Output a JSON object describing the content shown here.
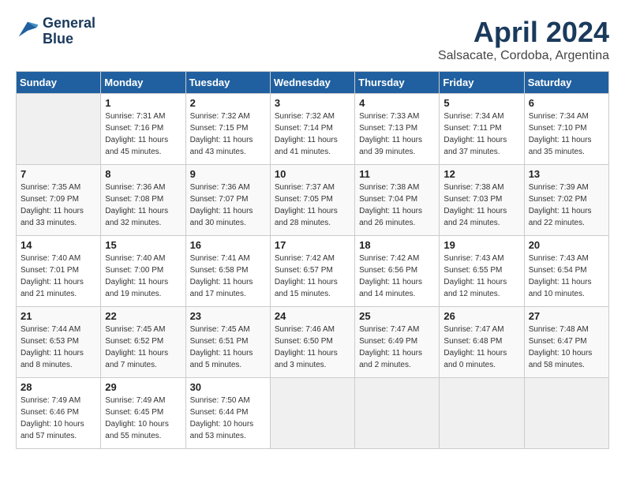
{
  "header": {
    "logo_line1": "General",
    "logo_line2": "Blue",
    "month": "April 2024",
    "location": "Salsacate, Cordoba, Argentina"
  },
  "columns": [
    "Sunday",
    "Monday",
    "Tuesday",
    "Wednesday",
    "Thursday",
    "Friday",
    "Saturday"
  ],
  "weeks": [
    [
      {
        "day": "",
        "empty": true
      },
      {
        "day": "1",
        "sunrise": "Sunrise: 7:31 AM",
        "sunset": "Sunset: 7:16 PM",
        "daylight": "Daylight: 11 hours and 45 minutes."
      },
      {
        "day": "2",
        "sunrise": "Sunrise: 7:32 AM",
        "sunset": "Sunset: 7:15 PM",
        "daylight": "Daylight: 11 hours and 43 minutes."
      },
      {
        "day": "3",
        "sunrise": "Sunrise: 7:32 AM",
        "sunset": "Sunset: 7:14 PM",
        "daylight": "Daylight: 11 hours and 41 minutes."
      },
      {
        "day": "4",
        "sunrise": "Sunrise: 7:33 AM",
        "sunset": "Sunset: 7:13 PM",
        "daylight": "Daylight: 11 hours and 39 minutes."
      },
      {
        "day": "5",
        "sunrise": "Sunrise: 7:34 AM",
        "sunset": "Sunset: 7:11 PM",
        "daylight": "Daylight: 11 hours and 37 minutes."
      },
      {
        "day": "6",
        "sunrise": "Sunrise: 7:34 AM",
        "sunset": "Sunset: 7:10 PM",
        "daylight": "Daylight: 11 hours and 35 minutes."
      }
    ],
    [
      {
        "day": "7",
        "sunrise": "Sunrise: 7:35 AM",
        "sunset": "Sunset: 7:09 PM",
        "daylight": "Daylight: 11 hours and 33 minutes."
      },
      {
        "day": "8",
        "sunrise": "Sunrise: 7:36 AM",
        "sunset": "Sunset: 7:08 PM",
        "daylight": "Daylight: 11 hours and 32 minutes."
      },
      {
        "day": "9",
        "sunrise": "Sunrise: 7:36 AM",
        "sunset": "Sunset: 7:07 PM",
        "daylight": "Daylight: 11 hours and 30 minutes."
      },
      {
        "day": "10",
        "sunrise": "Sunrise: 7:37 AM",
        "sunset": "Sunset: 7:05 PM",
        "daylight": "Daylight: 11 hours and 28 minutes."
      },
      {
        "day": "11",
        "sunrise": "Sunrise: 7:38 AM",
        "sunset": "Sunset: 7:04 PM",
        "daylight": "Daylight: 11 hours and 26 minutes."
      },
      {
        "day": "12",
        "sunrise": "Sunrise: 7:38 AM",
        "sunset": "Sunset: 7:03 PM",
        "daylight": "Daylight: 11 hours and 24 minutes."
      },
      {
        "day": "13",
        "sunrise": "Sunrise: 7:39 AM",
        "sunset": "Sunset: 7:02 PM",
        "daylight": "Daylight: 11 hours and 22 minutes."
      }
    ],
    [
      {
        "day": "14",
        "sunrise": "Sunrise: 7:40 AM",
        "sunset": "Sunset: 7:01 PM",
        "daylight": "Daylight: 11 hours and 21 minutes."
      },
      {
        "day": "15",
        "sunrise": "Sunrise: 7:40 AM",
        "sunset": "Sunset: 7:00 PM",
        "daylight": "Daylight: 11 hours and 19 minutes."
      },
      {
        "day": "16",
        "sunrise": "Sunrise: 7:41 AM",
        "sunset": "Sunset: 6:58 PM",
        "daylight": "Daylight: 11 hours and 17 minutes."
      },
      {
        "day": "17",
        "sunrise": "Sunrise: 7:42 AM",
        "sunset": "Sunset: 6:57 PM",
        "daylight": "Daylight: 11 hours and 15 minutes."
      },
      {
        "day": "18",
        "sunrise": "Sunrise: 7:42 AM",
        "sunset": "Sunset: 6:56 PM",
        "daylight": "Daylight: 11 hours and 14 minutes."
      },
      {
        "day": "19",
        "sunrise": "Sunrise: 7:43 AM",
        "sunset": "Sunset: 6:55 PM",
        "daylight": "Daylight: 11 hours and 12 minutes."
      },
      {
        "day": "20",
        "sunrise": "Sunrise: 7:43 AM",
        "sunset": "Sunset: 6:54 PM",
        "daylight": "Daylight: 11 hours and 10 minutes."
      }
    ],
    [
      {
        "day": "21",
        "sunrise": "Sunrise: 7:44 AM",
        "sunset": "Sunset: 6:53 PM",
        "daylight": "Daylight: 11 hours and 8 minutes."
      },
      {
        "day": "22",
        "sunrise": "Sunrise: 7:45 AM",
        "sunset": "Sunset: 6:52 PM",
        "daylight": "Daylight: 11 hours and 7 minutes."
      },
      {
        "day": "23",
        "sunrise": "Sunrise: 7:45 AM",
        "sunset": "Sunset: 6:51 PM",
        "daylight": "Daylight: 11 hours and 5 minutes."
      },
      {
        "day": "24",
        "sunrise": "Sunrise: 7:46 AM",
        "sunset": "Sunset: 6:50 PM",
        "daylight": "Daylight: 11 hours and 3 minutes."
      },
      {
        "day": "25",
        "sunrise": "Sunrise: 7:47 AM",
        "sunset": "Sunset: 6:49 PM",
        "daylight": "Daylight: 11 hours and 2 minutes."
      },
      {
        "day": "26",
        "sunrise": "Sunrise: 7:47 AM",
        "sunset": "Sunset: 6:48 PM",
        "daylight": "Daylight: 11 hours and 0 minutes."
      },
      {
        "day": "27",
        "sunrise": "Sunrise: 7:48 AM",
        "sunset": "Sunset: 6:47 PM",
        "daylight": "Daylight: 10 hours and 58 minutes."
      }
    ],
    [
      {
        "day": "28",
        "sunrise": "Sunrise: 7:49 AM",
        "sunset": "Sunset: 6:46 PM",
        "daylight": "Daylight: 10 hours and 57 minutes."
      },
      {
        "day": "29",
        "sunrise": "Sunrise: 7:49 AM",
        "sunset": "Sunset: 6:45 PM",
        "daylight": "Daylight: 10 hours and 55 minutes."
      },
      {
        "day": "30",
        "sunrise": "Sunrise: 7:50 AM",
        "sunset": "Sunset: 6:44 PM",
        "daylight": "Daylight: 10 hours and 53 minutes."
      },
      {
        "day": "",
        "empty": true
      },
      {
        "day": "",
        "empty": true
      },
      {
        "day": "",
        "empty": true
      },
      {
        "day": "",
        "empty": true
      }
    ]
  ]
}
